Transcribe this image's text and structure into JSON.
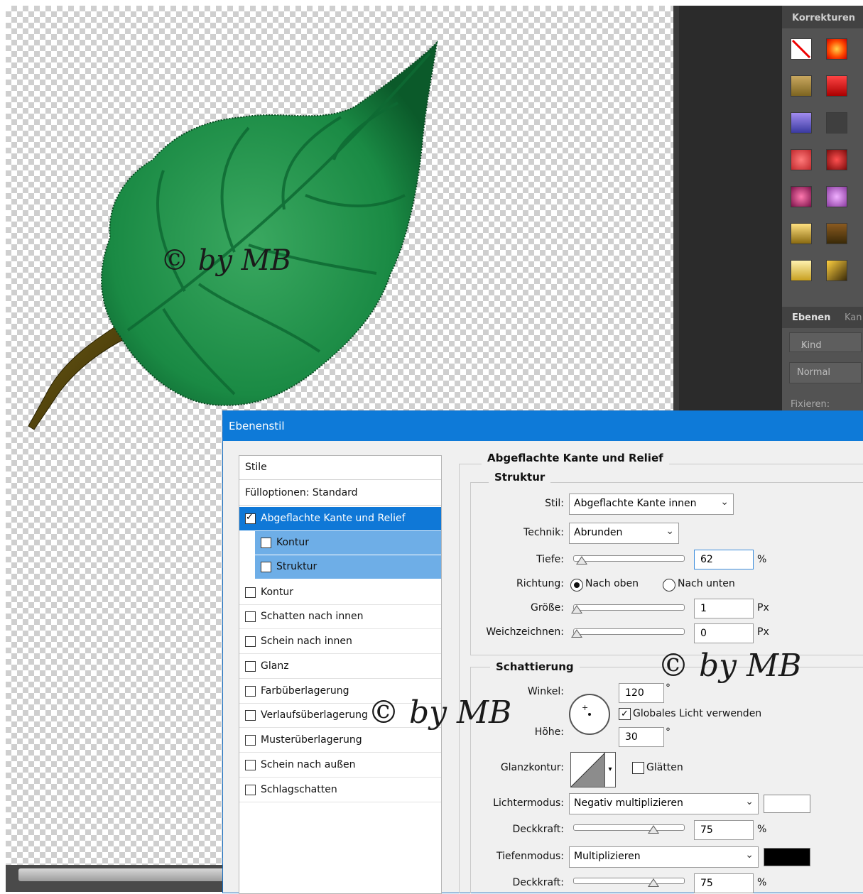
{
  "canvas": {
    "watermark": "© by MB"
  },
  "adjust_panel": {
    "title": "Korrekturen"
  },
  "layers_panel": {
    "tab_layers": "Ebenen",
    "tab_channels": "Kan",
    "kind_filter": "Kind",
    "blend_mode": "Normal",
    "lock_label": "Fixieren:"
  },
  "dialog": {
    "title": "Ebenenstil",
    "styles_header": "Stile",
    "fill_options": "Fülloptionen: Standard",
    "styles": [
      {
        "label": "Abgeflachte Kante und Relief",
        "checked": true
      },
      {
        "label": "Kontur",
        "checked": false
      },
      {
        "label": "Struktur",
        "checked": false
      },
      {
        "label": "Kontur",
        "checked": false
      },
      {
        "label": "Schatten nach innen",
        "checked": false
      },
      {
        "label": "Schein nach innen",
        "checked": false
      },
      {
        "label": "Glanz",
        "checked": false
      },
      {
        "label": "Farbüberlagerung",
        "checked": false
      },
      {
        "label": "Verlaufsüberlagerung",
        "checked": false
      },
      {
        "label": "Musterüberlagerung",
        "checked": false
      },
      {
        "label": "Schein nach außen",
        "checked": false
      },
      {
        "label": "Schlagschatten",
        "checked": false
      }
    ],
    "section_title": "Abgeflachte Kante und Relief",
    "structure": {
      "title": "Struktur",
      "style_label": "Stil:",
      "style_value": "Abgeflachte Kante innen",
      "technique_label": "Technik:",
      "technique_value": "Abrunden",
      "depth_label": "Tiefe:",
      "depth_value": "62",
      "depth_unit": "%",
      "direction_label": "Richtung:",
      "direction_up": "Nach oben",
      "direction_down": "Nach unten",
      "size_label": "Größe:",
      "size_value": "1",
      "size_unit": "Px",
      "soften_label": "Weichzeichnen:",
      "soften_value": "0",
      "soften_unit": "Px"
    },
    "shading": {
      "title": "Schattierung",
      "angle_label": "Winkel:",
      "angle_value": "120",
      "deg": "°",
      "global_light": "Globales Licht verwenden",
      "altitude_label": "Höhe:",
      "altitude_value": "30",
      "gloss_label": "Glanzkontur:",
      "antialias": "Glätten",
      "highlight_mode_label": "Lichtermodus:",
      "highlight_mode": "Negativ multiplizieren",
      "highlight_color": "#ffffff",
      "opacity_label": "Deckkraft:",
      "highlight_opacity": "75",
      "pct": "%",
      "shadow_mode_label": "Tiefenmodus:",
      "shadow_mode": "Multiplizieren",
      "shadow_color": "#000000",
      "shadow_opacity_label": "Deckkraft:",
      "shadow_opacity": "75"
    }
  }
}
